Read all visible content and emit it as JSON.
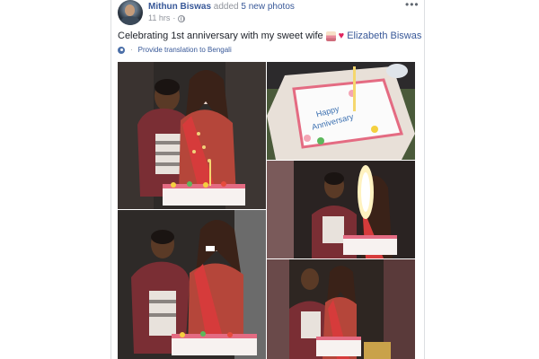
{
  "post": {
    "author": "Mithun Biswas",
    "action_text": "added",
    "action_link": "5 new photos",
    "time": "11 hrs",
    "meta_sep": "·",
    "text_main": "Celebrating 1st anniversary with my sweet wife",
    "tagged_name": "Elizabeth Biswas",
    "translate_link": "Provide translation to Bengali",
    "more_label": "•••"
  },
  "photos": [
    {
      "alt": "couple cutting anniversary cake"
    },
    {
      "alt": "anniversary cake with candle"
    },
    {
      "alt": "cake with sparkler candle"
    },
    {
      "alt": "husband feeding wife cake"
    },
    {
      "alt": "couple with cake and family"
    }
  ],
  "colors": {
    "link": "#385898",
    "muted": "#90949c",
    "text": "#1d2129"
  }
}
